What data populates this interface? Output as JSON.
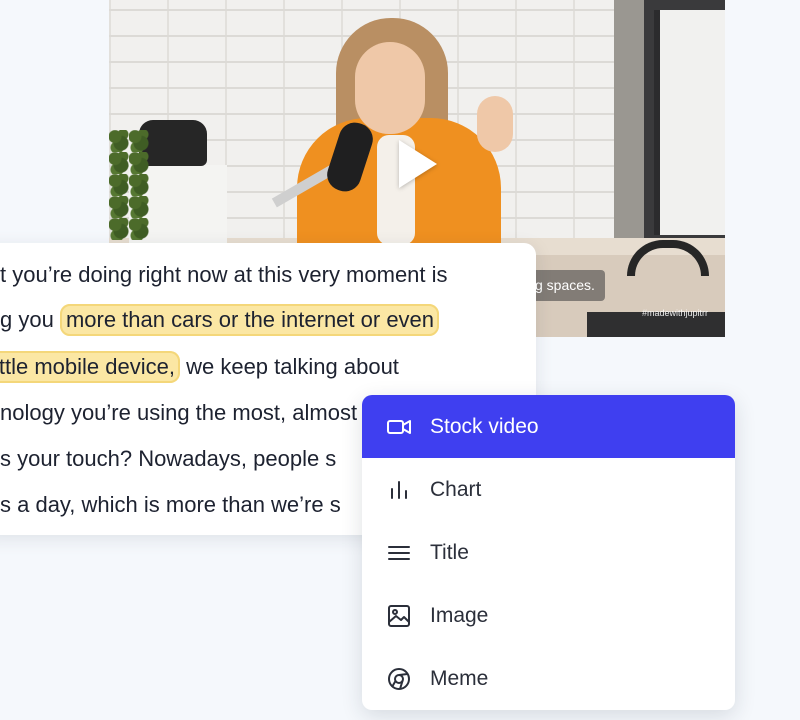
{
  "video": {
    "caption": "g spaces.",
    "watermark": "#madewithjupitrr"
  },
  "transcript": {
    "lines": [
      {
        "text": "t you’re doing right now at this very moment is"
      },
      {
        "pre": "g you ",
        "highlight": "more than cars or the internet or even"
      },
      {
        "highlight": "ittle mobile device,",
        "post": " we keep talking about"
      },
      {
        "text": "nology you’re using the most, almost"
      },
      {
        "text": "s your touch? Nowadays, people s"
      },
      {
        "text": "s a day, which is more than we’re s"
      }
    ]
  },
  "menu": {
    "items": [
      {
        "label": "Stock video",
        "icon": "video-camera-icon",
        "active": true
      },
      {
        "label": "Chart",
        "icon": "bar-chart-icon",
        "active": false
      },
      {
        "label": "Title",
        "icon": "title-lines-icon",
        "active": false
      },
      {
        "label": "Image",
        "icon": "image-icon",
        "active": false
      },
      {
        "label": "Meme",
        "icon": "chrome-icon",
        "active": false
      }
    ]
  },
  "colors": {
    "accent": "#3f3ff0",
    "highlight": "#fbe7a4",
    "text": "#1d2230"
  }
}
